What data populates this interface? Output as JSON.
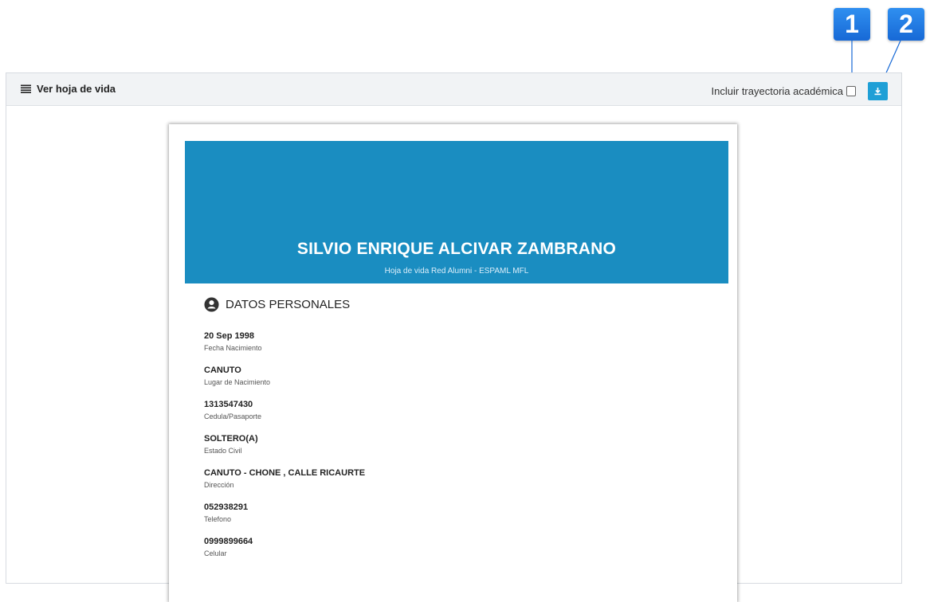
{
  "callouts": [
    "1",
    "2"
  ],
  "panel": {
    "title": "Ver hoja de vida",
    "include_label": "Incluir trayectoria académica",
    "include_checked": false,
    "title_icon": "menu-icon",
    "download_icon": "download-icon"
  },
  "cv": {
    "name": "SILVIO ENRIQUE ALCIVAR ZAMBRANO",
    "subtitle": "Hoja de vida Red Alumni - ESPAML MFL",
    "banner_color": "#1a8dc1",
    "section_title": "DATOS PERSONALES",
    "section_icon": "user-circle-icon",
    "fields": [
      {
        "value": "20 Sep 1998",
        "label": "Fecha Nacimiento"
      },
      {
        "value": "CANUTO",
        "label": "Lugar de Nacimiento"
      },
      {
        "value": "1313547430",
        "label": "Cedula/Pasaporte"
      },
      {
        "value": "SOLTERO(A)",
        "label": "Estado Civil"
      },
      {
        "value": "CANUTO - CHONE , CALLE RICAURTE",
        "label": "Dirección"
      },
      {
        "value": "052938291",
        "label": "Telefono"
      },
      {
        "value": "0999899664",
        "label": "Celular"
      }
    ]
  },
  "colors": {
    "accent": "#1e9fd6",
    "callout": "#1f7fe6",
    "header_bg": "#f1f3f5"
  }
}
